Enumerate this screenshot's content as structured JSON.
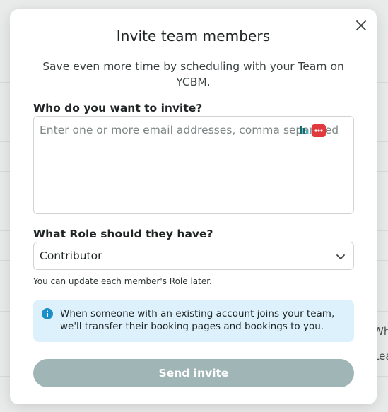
{
  "background": {
    "fragments": [
      "Wha",
      "Lea"
    ]
  },
  "modal": {
    "title": "Invite team members",
    "subtitle": "Save even more time by scheduling with your Team on YCBM.",
    "close_icon": "close-icon"
  },
  "invite": {
    "label": "Who do you want to invite?",
    "placeholder": "Enter one or more email addresses, comma separated",
    "value": ""
  },
  "role": {
    "label": "What Role should they have?",
    "selected": "Contributor",
    "helper": "You can update each member's Role later."
  },
  "notice": {
    "icon": "info-icon",
    "text": "When someone with an existing account joins your team, we'll transfer their booking pages and bookings to you."
  },
  "actions": {
    "send_label": "Send invite"
  },
  "colors": {
    "button": "#9fb5b6",
    "notice_bg": "#dcf1fb",
    "info_icon": "#1a8fc9"
  }
}
